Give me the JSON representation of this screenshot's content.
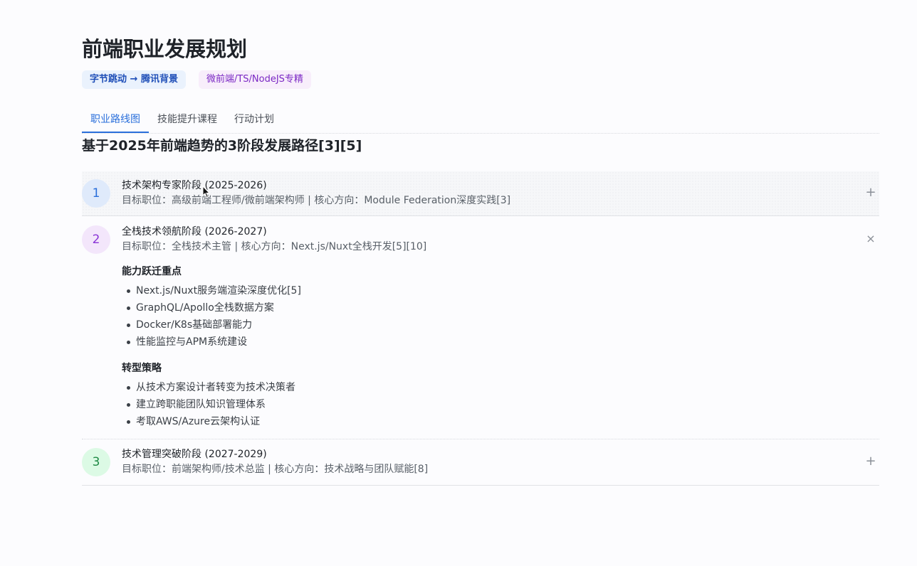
{
  "page": {
    "title": "前端职业发展规划",
    "badges": [
      {
        "label": "字节跳动 → 腾讯背景",
        "color": "#1f4fb8"
      },
      {
        "label": "微前端/TS/NodeJS专精",
        "color": "#7b28c4"
      }
    ]
  },
  "tabs": [
    {
      "label": "职业路线图",
      "active": true
    },
    {
      "label": "技能提升课程",
      "active": false
    },
    {
      "label": "行动计划",
      "active": false
    }
  ],
  "roadmap": {
    "heading": "基于2025年前端趋势的3阶段发展路径[3][5]",
    "stages": [
      {
        "number": "1",
        "title": "技术架构专家阶段 (2025-2026)",
        "subtitle": "目标职位：高级前端工程师/微前端架构师 | 核心方向：Module Federation深度实践[3]",
        "expanded": false,
        "toggle_icon": "plus-icon"
      },
      {
        "number": "2",
        "title": "全栈技术领航阶段 (2026-2027)",
        "subtitle": "目标职位：全栈技术主管 | 核心方向：Next.js/Nuxt全栈开发[5][10]",
        "expanded": true,
        "toggle_icon": "close-icon",
        "blocks": [
          {
            "title": "能力跃迁重点",
            "items": [
              "Next.js/Nuxt服务端渲染深度优化[5]",
              "GraphQL/Apollo全栈数据方案",
              "Docker/K8s基础部署能力",
              "性能监控与APM系统建设"
            ]
          },
          {
            "title": "转型策略",
            "items": [
              "从技术方案设计者转变为技术决策者",
              "建立跨职能团队知识管理体系",
              "考取AWS/Azure云架构认证"
            ]
          }
        ]
      },
      {
        "number": "3",
        "title": "技术管理突破阶段 (2027-2029)",
        "subtitle": "目标职位：前端架构师/技术总监 | 核心方向：技术战略与团队赋能[8]",
        "expanded": false,
        "toggle_icon": "plus-icon"
      }
    ]
  },
  "icons": {
    "plus": "+",
    "close": "×"
  },
  "colors": {
    "accent": "#2a6fdb",
    "stage1": "#2a6fdb",
    "stage2": "#8a35d6",
    "stage3": "#1f8a45"
  }
}
